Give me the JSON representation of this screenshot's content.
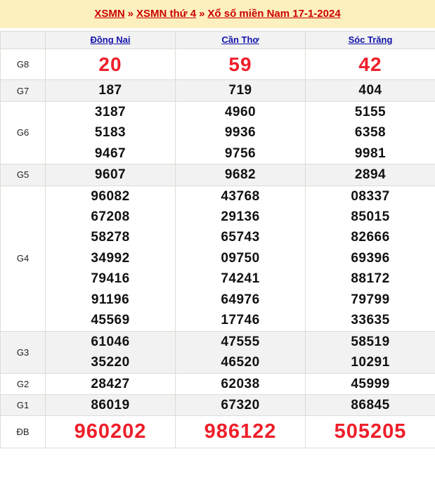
{
  "banner": {
    "crumbs": [
      {
        "text": "XSMN",
        "type": "link"
      },
      {
        "text": "»",
        "type": "sep"
      },
      {
        "text": "XSMN thứ 4",
        "type": "link"
      },
      {
        "text": "»",
        "type": "sep"
      },
      {
        "text": "Xổ số miền Nam 17-1-2024",
        "type": "link"
      }
    ],
    "link_color": "#cc0000",
    "background": "#fdf0bf"
  },
  "table": {
    "corner_label": "",
    "columns": [
      {
        "label": "Đồng Nai"
      },
      {
        "label": "Cần Thơ"
      },
      {
        "label": "Sóc Trăng"
      }
    ],
    "header_link_color": "#1111aa",
    "header_background": "#f2f2f2",
    "highlight_color": "#ee1f2a",
    "rows": [
      {
        "prize": "G8",
        "stripe": false,
        "highlight": "g8",
        "values": [
          [
            "20"
          ],
          [
            "59"
          ],
          [
            "42"
          ]
        ]
      },
      {
        "prize": "G7",
        "stripe": true,
        "highlight": "none",
        "values": [
          [
            "187"
          ],
          [
            "719"
          ],
          [
            "404"
          ]
        ]
      },
      {
        "prize": "G6",
        "stripe": false,
        "highlight": "none",
        "values": [
          [
            "3187",
            "5183",
            "9467"
          ],
          [
            "4960",
            "9936",
            "9756"
          ],
          [
            "5155",
            "6358",
            "9981"
          ]
        ]
      },
      {
        "prize": "G5",
        "stripe": true,
        "highlight": "none",
        "values": [
          [
            "9607"
          ],
          [
            "9682"
          ],
          [
            "2894"
          ]
        ]
      },
      {
        "prize": "G4",
        "stripe": false,
        "highlight": "none",
        "values": [
          [
            "96082",
            "67208",
            "58278",
            "34992",
            "79416",
            "91196",
            "45569"
          ],
          [
            "43768",
            "29136",
            "65743",
            "09750",
            "74241",
            "64976",
            "17746"
          ],
          [
            "08337",
            "85015",
            "82666",
            "69396",
            "88172",
            "79799",
            "33635"
          ]
        ]
      },
      {
        "prize": "G3",
        "stripe": true,
        "highlight": "none",
        "values": [
          [
            "61046",
            "35220"
          ],
          [
            "47555",
            "46520"
          ],
          [
            "58519",
            "10291"
          ]
        ]
      },
      {
        "prize": "G2",
        "stripe": false,
        "highlight": "none",
        "values": [
          [
            "28427"
          ],
          [
            "62038"
          ],
          [
            "45999"
          ]
        ]
      },
      {
        "prize": "G1",
        "stripe": true,
        "highlight": "none",
        "values": [
          [
            "86019"
          ],
          [
            "67320"
          ],
          [
            "86845"
          ]
        ]
      },
      {
        "prize": "ĐB",
        "stripe": false,
        "highlight": "db",
        "values": [
          [
            "960202"
          ],
          [
            "986122"
          ],
          [
            "505205"
          ]
        ]
      }
    ]
  }
}
